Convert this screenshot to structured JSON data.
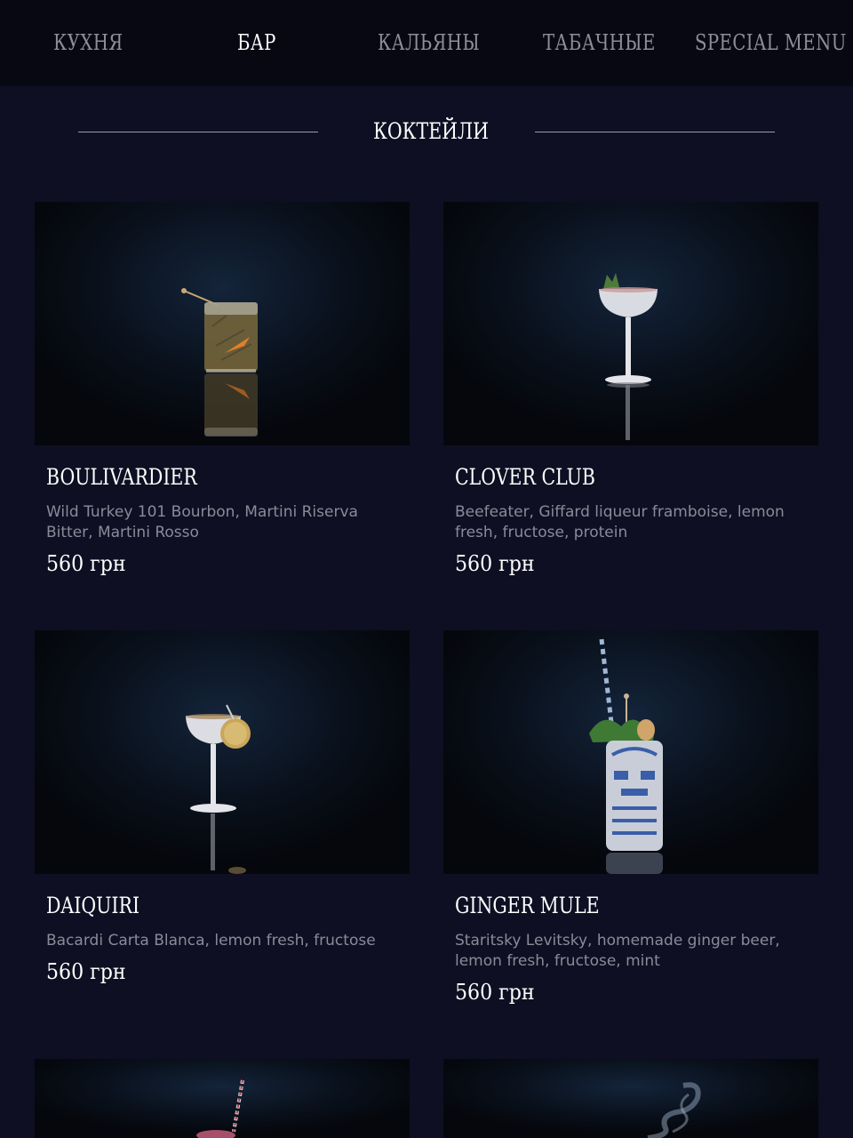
{
  "nav": {
    "items": [
      {
        "label": "КУХНЯ",
        "active": false
      },
      {
        "label": "БАР",
        "active": true
      },
      {
        "label": "КАЛЬЯНЫ",
        "active": false
      },
      {
        "label": "ТАБАЧНЫЕ",
        "active": false
      },
      {
        "label": "SPECIAL MENU",
        "active": false
      }
    ]
  },
  "section": {
    "title": "КОКТЕЙЛИ"
  },
  "items": [
    {
      "name": "BOULIVARDIER",
      "description": "Wild Turkey 101 Bourbon, Martini Riserva Bitter, Martini Rosso",
      "price": "560 грн",
      "photo_icon": "rocks-glass-icon"
    },
    {
      "name": "CLOVER CLUB",
      "description": "Beefeater,  Giffard liqueur framboise, lemon fresh, fructose, protein",
      "price": "560 грн",
      "photo_icon": "coupe-glass-icon"
    },
    {
      "name": "DAIQUIRI",
      "description": "Bacardi Carta Blanca, lemon fresh, fructose",
      "price": "560 грн",
      "photo_icon": "coupe-glass-icon"
    },
    {
      "name": "GINGER MULE",
      "description": "Staritsky Levitsky, homemade ginger beer, lemon fresh, fructose, mint",
      "price": "560 грн",
      "photo_icon": "tiki-mug-icon"
    }
  ],
  "partial_items": [
    {
      "photo_icon": "cocktail-glass-with-straw-icon"
    },
    {
      "photo_icon": "smoke-icon"
    }
  ],
  "colors": {
    "page_background": "#0e0f22",
    "nav_background": "#070812",
    "nav_inactive": "#8d8e98",
    "nav_active": "#ffffff",
    "description_text": "#8a8b98",
    "title_text": "#ffffff"
  }
}
